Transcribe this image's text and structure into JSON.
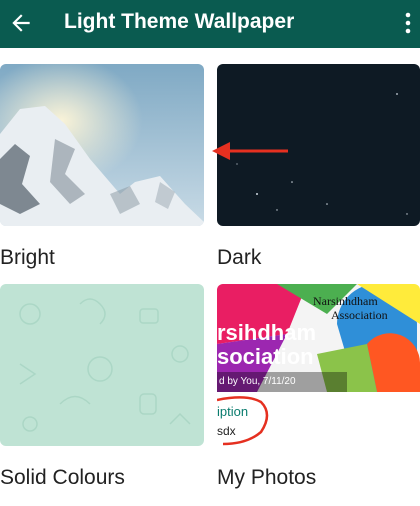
{
  "appbar": {
    "title": "Light Theme Wallpaper",
    "back_icon": "arrow-left-icon",
    "menu_icon": "more-vert-icon",
    "color": "#0a5b50"
  },
  "categories": [
    {
      "label": "Bright"
    },
    {
      "label": "Dark"
    },
    {
      "label": "Solid Colours"
    },
    {
      "label": "My Photos"
    }
  ],
  "my_photos_preview": {
    "org_name_line1": "Narsinhdham",
    "org_name_line2": "Association",
    "banner_line1": "rsihdham",
    "banner_line2": "sociation",
    "caption": "d by You, 7/11/20",
    "field_label": "iption",
    "field_value": "sdx"
  },
  "annotation": {
    "arrow_color": "#e53020",
    "circle_color": "#e53020"
  }
}
